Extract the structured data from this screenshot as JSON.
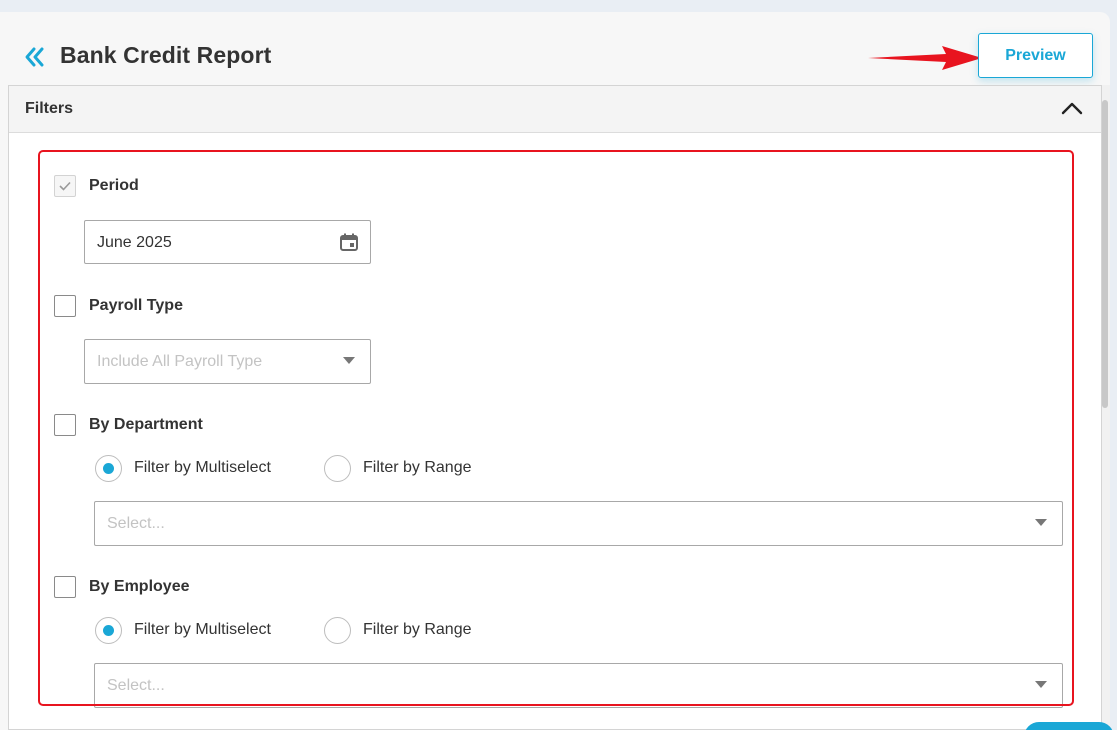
{
  "header": {
    "title": "Bank Credit Report",
    "back_icon": "double-chevron-left-icon",
    "preview_label": "Preview"
  },
  "filters": {
    "title": "Filters",
    "collapse_icon": "chevron-up-icon",
    "period": {
      "label": "Period",
      "checked": true,
      "value": "June 2025",
      "icon": "calendar-icon"
    },
    "payroll_type": {
      "label": "Payroll Type",
      "checked": false,
      "placeholder": "Include All Payroll Type",
      "icon": "caret-down-icon"
    },
    "by_department": {
      "label": "By Department",
      "checked": false,
      "radio_multiselect": "Filter by Multiselect",
      "radio_range": "Filter by Range",
      "selected": "multiselect",
      "placeholder": "Select..."
    },
    "by_employee": {
      "label": "By Employee",
      "checked": false,
      "radio_multiselect": "Filter by Multiselect",
      "radio_range": "Filter by Range",
      "selected": "multiselect",
      "placeholder": "Select..."
    }
  },
  "colors": {
    "accent": "#1aa7d6",
    "annotation": "#e8141f",
    "background": "#e9eef4"
  }
}
